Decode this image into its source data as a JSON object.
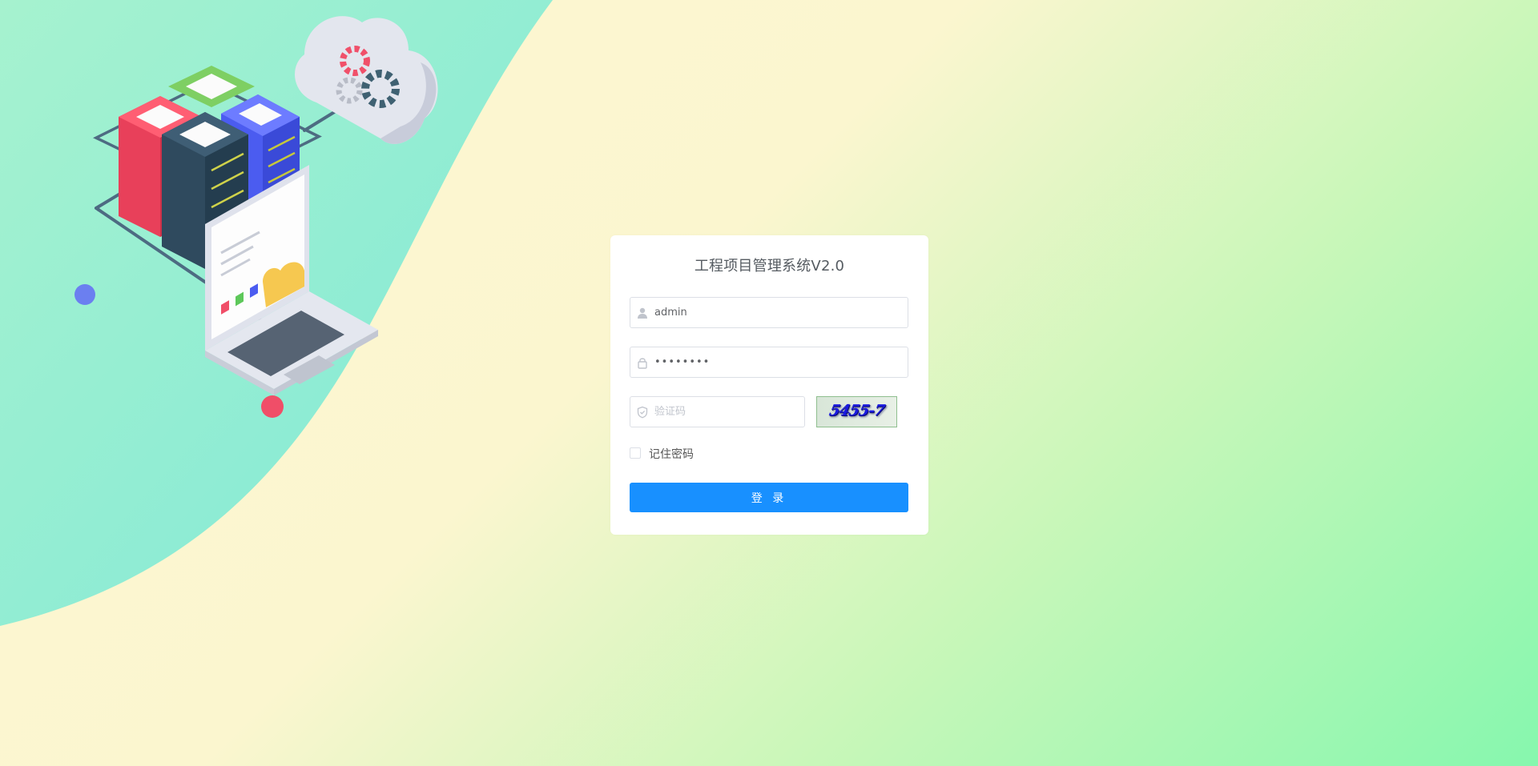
{
  "login": {
    "title": "工程项目管理系统V2.0",
    "username_value": "admin",
    "password_value": "••••••••",
    "captcha_placeholder": "验证码",
    "captcha_text": "5455-7",
    "remember_label": "记住密码",
    "submit_label": "登 录"
  },
  "icons": {
    "username": "user-icon",
    "password": "lock-icon",
    "captcha": "shield-icon"
  },
  "colors": {
    "primary": "#1890ff",
    "background_left": "#fdf7d2",
    "background_right": "#86f7ae",
    "wave": "#8de9d3"
  }
}
